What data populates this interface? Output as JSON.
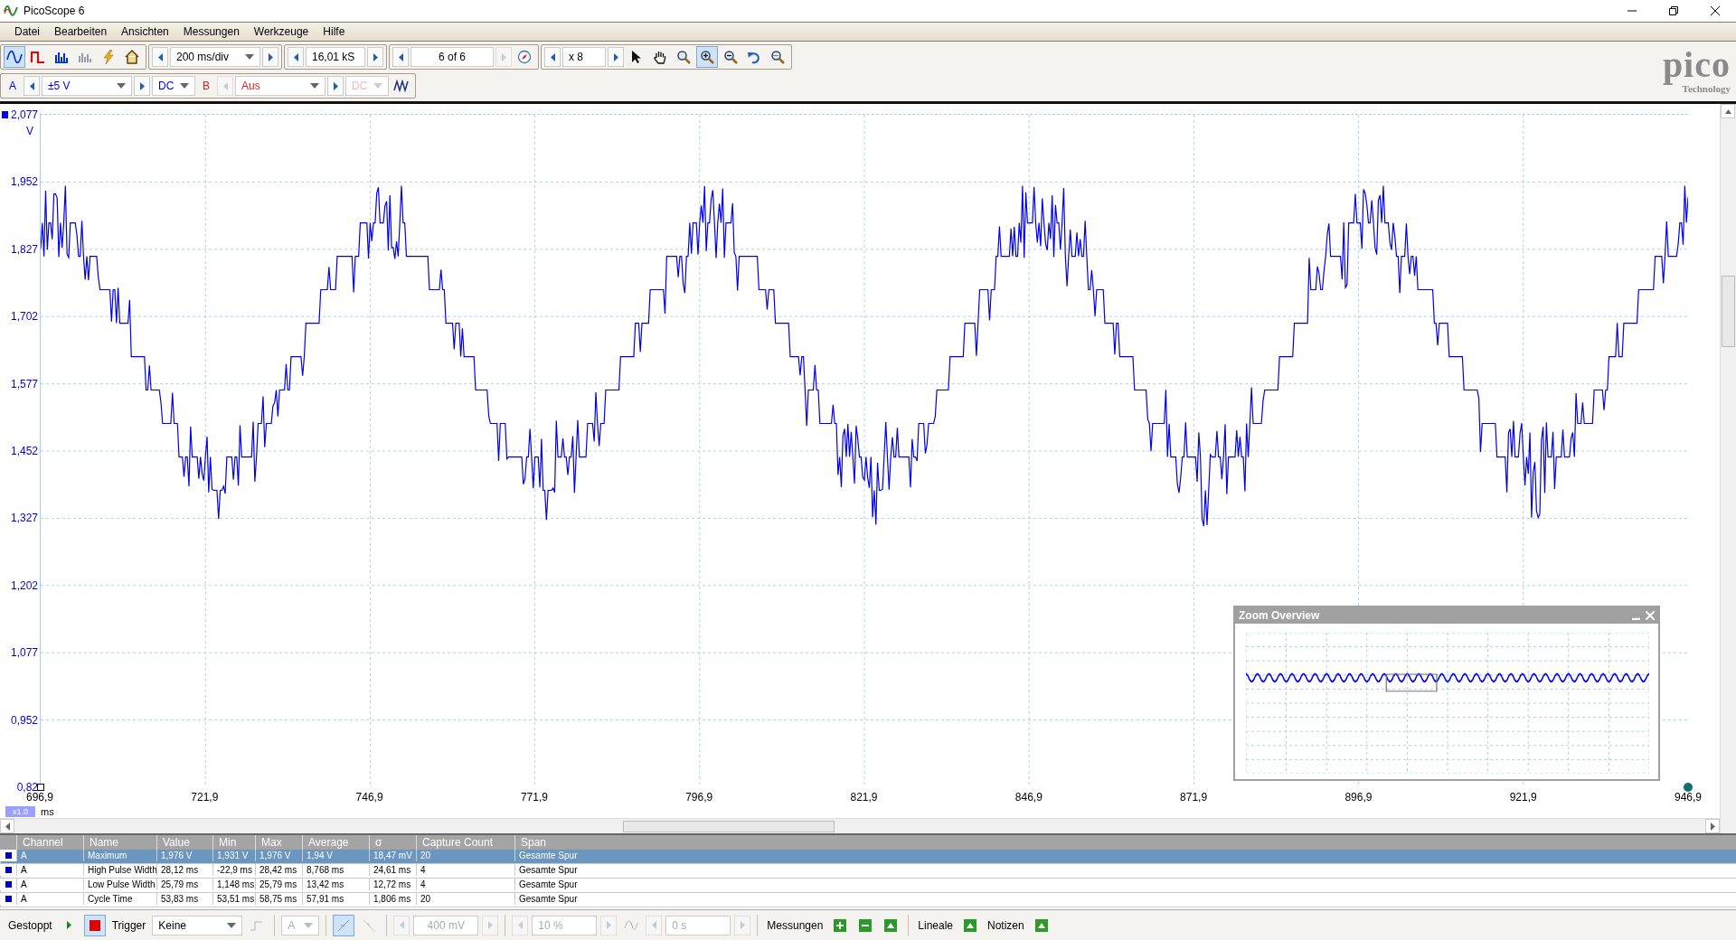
{
  "window": {
    "title": "PicoScope 6"
  },
  "menu": [
    "Datei",
    "Bearbeiten",
    "Ansichten",
    "Messungen",
    "Werkzeuge",
    "Hilfe"
  ],
  "toolbar": {
    "view_buttons": [
      {
        "kind": "scope",
        "selected": true
      },
      {
        "kind": "persistence",
        "selected": false
      },
      {
        "kind": "spectrum",
        "selected": false
      },
      {
        "kind": "histogram",
        "selected": false
      }
    ],
    "timebase": "200 ms/div",
    "samples": "16,01 kS",
    "buffer": "6 of 6",
    "zoom_factor": "x 8",
    "tools": [
      {
        "kind": "pointer",
        "selected": false
      },
      {
        "kind": "hand",
        "selected": false
      },
      {
        "kind": "zoom",
        "selected": false
      },
      {
        "kind": "zoom-in",
        "selected": true
      },
      {
        "kind": "zoom-out",
        "selected": false
      },
      {
        "kind": "undo",
        "selected": false
      },
      {
        "kind": "overview",
        "selected": false
      }
    ]
  },
  "logo": {
    "name": "pico",
    "sub": "Technology"
  },
  "channels": [
    {
      "label": "A",
      "color": "#0000ff",
      "range": "±5 V",
      "coupling": "DC",
      "enabled": true
    },
    {
      "label": "B",
      "color": "#e02020",
      "range": "Aus",
      "coupling": "DC",
      "enabled": false
    }
  ],
  "plot": {
    "y_labels": [
      "2,077",
      "1,952",
      "1,827",
      "1,702",
      "1,577",
      "1,452",
      "1,327",
      "1,202",
      "1,077",
      "0,952",
      "0,82"
    ],
    "y_unit": "V",
    "x_labels": [
      "696,9",
      "721,9",
      "746,9",
      "771,9",
      "796,9",
      "821,9",
      "846,9",
      "871,9",
      "896,9",
      "921,9",
      "946,9"
    ],
    "x_scale": "x1.0",
    "x_unit": "ms"
  },
  "zoom_overview": {
    "title": "Zoom Overview"
  },
  "measurements": {
    "columns": [
      "Channel",
      "Name",
      "Value",
      "Min",
      "Max",
      "Average",
      "σ",
      "Capture Count",
      "Span"
    ],
    "rows": [
      {
        "selected": true,
        "cells": [
          "A",
          "Maximum",
          "1,976 V",
          "1,931 V",
          "1,976 V",
          "1,94 V",
          "18,47 mV",
          "20",
          "Gesamte Spur"
        ]
      },
      {
        "selected": false,
        "cells": [
          "A",
          "High Pulse Width",
          "28,12 ms",
          "-22,9 ms",
          "28,42 ms",
          "8,768 ms",
          "24,61 ms",
          "4",
          "Gesamte Spur"
        ]
      },
      {
        "selected": false,
        "cells": [
          "A",
          "Low Pulse Width",
          "25,79 ms",
          "1,148 ms",
          "25,79 ms",
          "13,42 ms",
          "12,72 ms",
          "4",
          "Gesamte Spur"
        ]
      },
      {
        "selected": false,
        "cells": [
          "A",
          "Cycle Time",
          "53,83 ms",
          "53,51 ms",
          "58,75 ms",
          "57,91 ms",
          "1,806 ms",
          "20",
          "Gesamte Spur"
        ]
      }
    ]
  },
  "status_bar": {
    "state": "Gestoppt",
    "stopped": true,
    "trigger_label": "Trigger",
    "trigger_mode": "Keine",
    "trigger_channel": "A",
    "threshold": "400 mV",
    "pretrigger": "10 %",
    "delay": "0 s",
    "measurements_label": "Messungen",
    "rulers_label": "Lineale",
    "notes_label": "Notizen"
  }
}
